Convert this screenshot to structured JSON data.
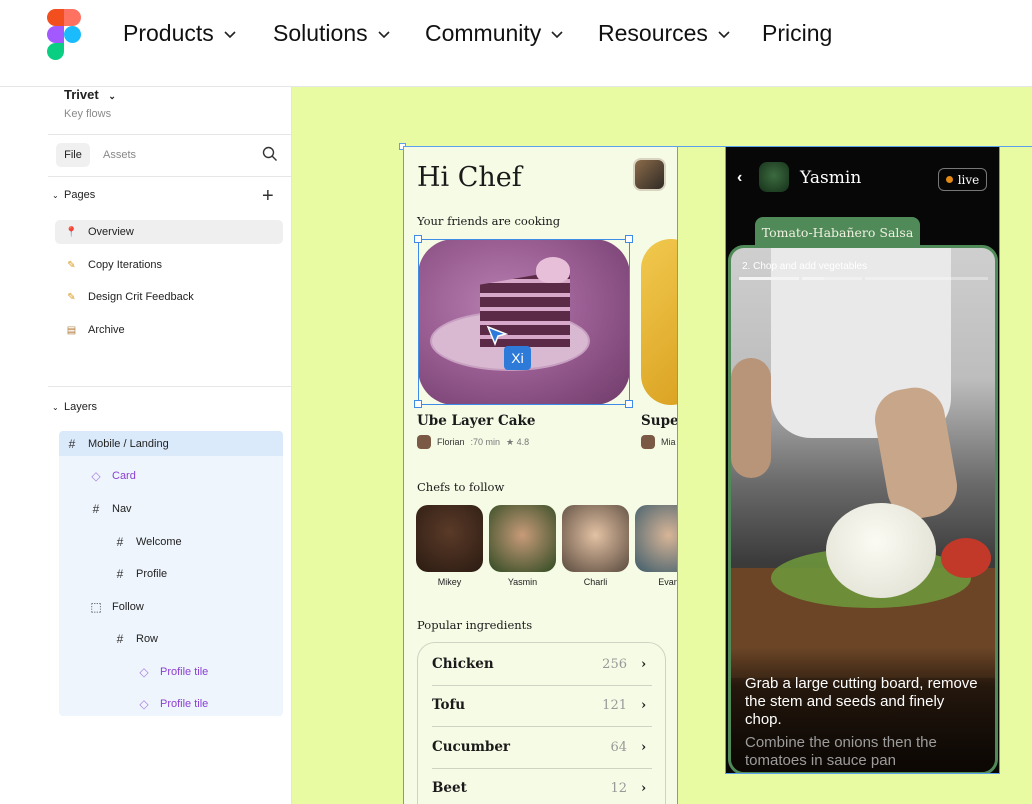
{
  "nav": {
    "items": [
      "Products",
      "Solutions",
      "Community",
      "Resources",
      "Pricing"
    ]
  },
  "panel": {
    "project_name": "Trivet",
    "project_sub": "Key flows",
    "tabs": {
      "file": "File",
      "assets": "Assets"
    },
    "pages_header": "Pages",
    "pages": [
      {
        "label": "Overview",
        "icon": "pin-icon"
      },
      {
        "label": "Copy Iterations",
        "icon": "pencil-icon"
      },
      {
        "label": "Design Crit Feedback",
        "icon": "pencil-icon"
      },
      {
        "label": "Archive",
        "icon": "box-icon"
      }
    ],
    "layers_header": "Layers",
    "layers": [
      {
        "label": "Mobile / Landing",
        "type": "frame"
      },
      {
        "label": "Card",
        "type": "component"
      },
      {
        "label": "Nav",
        "type": "frame"
      },
      {
        "label": "Welcome",
        "type": "frame"
      },
      {
        "label": "Profile",
        "type": "frame"
      },
      {
        "label": "Follow",
        "type": "section"
      },
      {
        "label": "Row",
        "type": "frame"
      },
      {
        "label": "Profile tile",
        "type": "component"
      },
      {
        "label": "Profile tile",
        "type": "component"
      }
    ]
  },
  "mobile1": {
    "greeting": "Hi Chef",
    "friends_header": "Your friends are cooking",
    "cursor_label": "Xi",
    "cards": [
      {
        "title": "Ube Layer Cake",
        "author": "Florian",
        "time": ":70 min",
        "rating": "★ 4.8"
      },
      {
        "title": "Super",
        "author": "Mia"
      }
    ],
    "chefs_header": "Chefs to follow",
    "chefs": [
      "Mikey",
      "Yasmin",
      "Charli",
      "Evan"
    ],
    "ingredients_header": "Popular ingredients",
    "ingredients": [
      {
        "name": "Chicken",
        "count": "256"
      },
      {
        "name": "Tofu",
        "count": "121"
      },
      {
        "name": "Cucumber",
        "count": "64"
      },
      {
        "name": "Beet",
        "count": "12"
      }
    ],
    "chevron": "›"
  },
  "mobile2": {
    "back": "‹",
    "name": "Yasmin",
    "live": "live",
    "recipe": "Tomato-Habañero Salsa",
    "step": "2.  Chop and add vegetables",
    "instruction": "Grab a large cutting board, remove the stem and seeds and finely chop.",
    "next_instruction": "Combine the onions then the tomatoes in sauce pan"
  },
  "colors": {
    "canvas": "#e8fba3",
    "selection": "#3e8be8",
    "component": "#8a3fd1",
    "live_dot": "#e28a14",
    "recipe_tab": "#4f8a58"
  }
}
